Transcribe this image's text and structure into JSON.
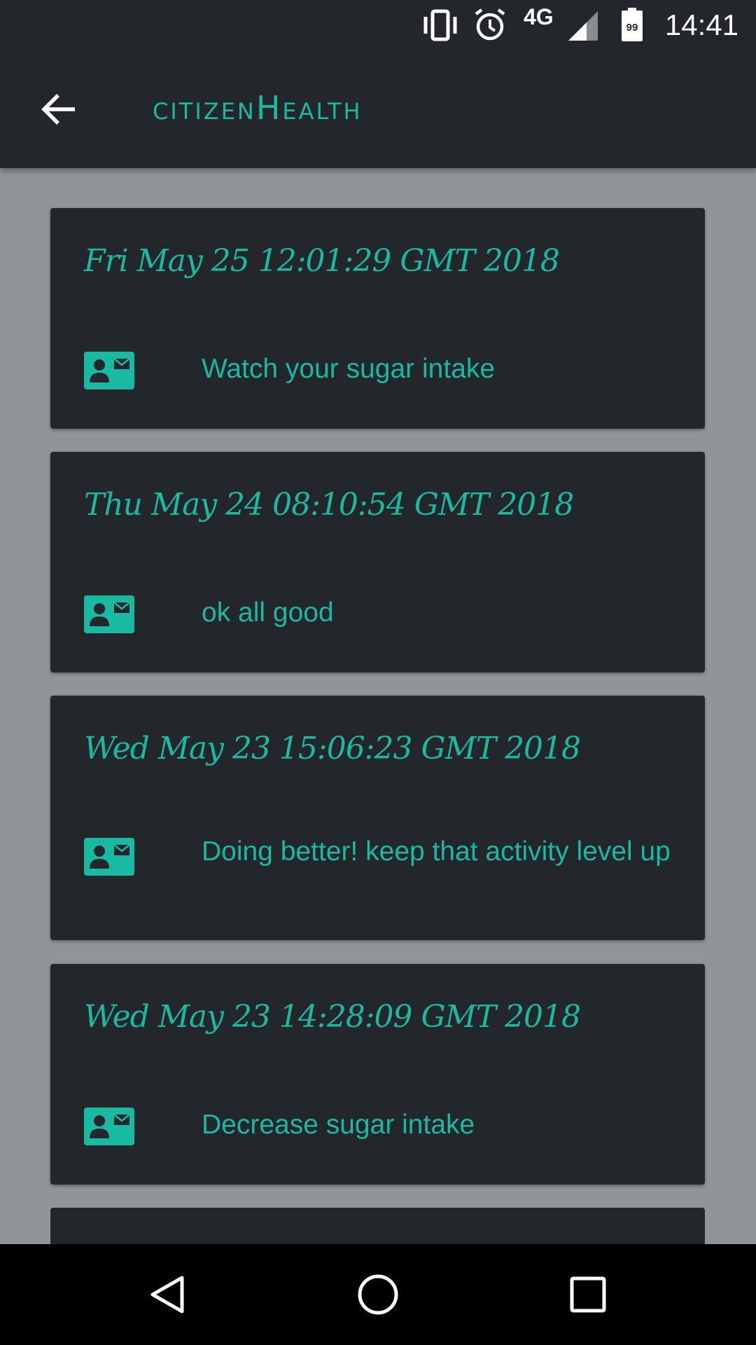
{
  "status_bar": {
    "time": "14:41",
    "network": "4G",
    "battery_level": "99",
    "icons": [
      "vibrate-icon",
      "alarm-icon",
      "signal-icon",
      "battery-icon"
    ]
  },
  "app_bar": {
    "title": "citizenHealth",
    "back_icon": "arrow-back-icon"
  },
  "messages": [
    {
      "date": "Fri May 25 12:01:29 GMT 2018",
      "text": "Watch your sugar intake",
      "icon": "contact-mail-icon"
    },
    {
      "date": "Thu May 24 08:10:54 GMT 2018",
      "text": "ok all good",
      "icon": "contact-mail-icon"
    },
    {
      "date": "Wed May 23 15:06:23 GMT 2018",
      "text": "Doing better! keep that activity level up",
      "icon": "contact-mail-icon"
    },
    {
      "date": "Wed May 23 14:28:09 GMT 2018",
      "text": "Decrease sugar intake",
      "icon": "contact-mail-icon"
    }
  ],
  "nav_bar": {
    "buttons": [
      "back-triangle-icon",
      "home-circle-icon",
      "recents-square-icon"
    ]
  },
  "colors": {
    "accent": "#1ab9a2",
    "bar_background": "#23272c",
    "page_background": "#919599",
    "nav_background": "#000000"
  }
}
